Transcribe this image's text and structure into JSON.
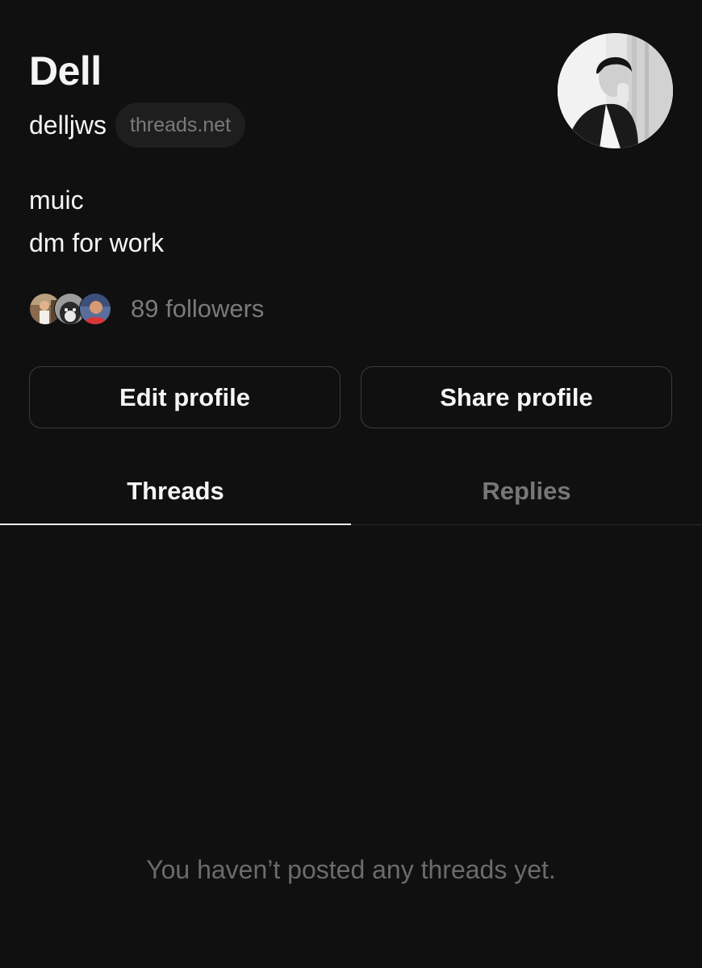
{
  "profile": {
    "name": "Dell",
    "handle": "delljws",
    "domain_badge": "threads.net",
    "bio_lines": [
      "muic",
      "dm for work"
    ],
    "followers_text": "89 followers"
  },
  "actions": {
    "edit_label": "Edit profile",
    "share_label": "Share profile"
  },
  "tabs": [
    {
      "label": "Threads",
      "active": true
    },
    {
      "label": "Replies",
      "active": false
    }
  ],
  "empty_state": "You haven’t posted any threads yet.",
  "colors": {
    "background": "#101010",
    "text_primary": "#f3f5f7",
    "text_secondary": "#7a7a7a",
    "button_border": "#3d3d3d"
  }
}
